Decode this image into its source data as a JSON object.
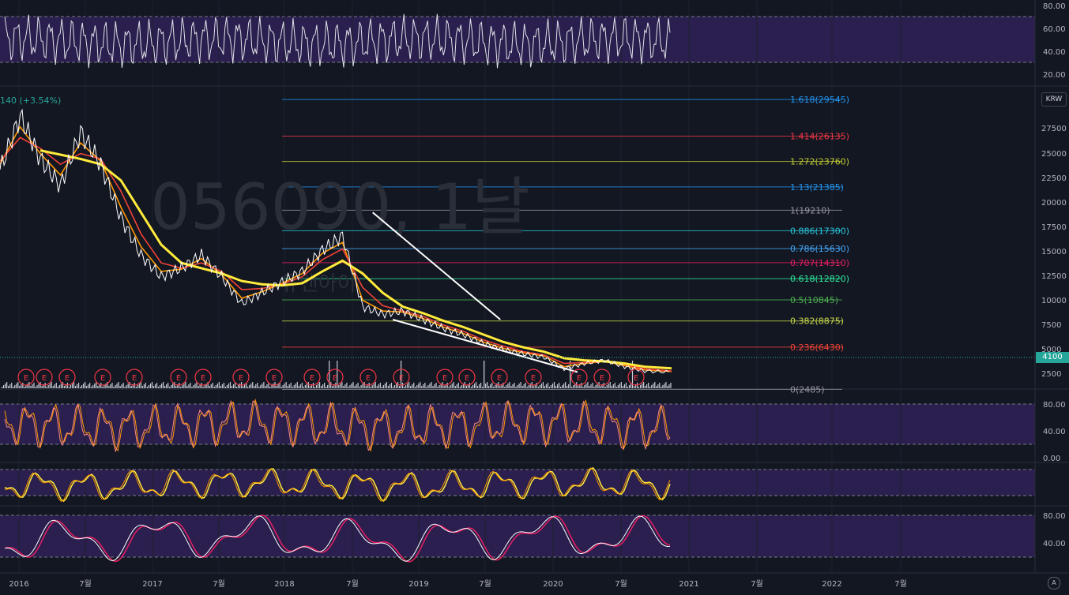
{
  "chart_data": {
    "type": "line",
    "symbol": "056090",
    "interval": "1날",
    "watermark": "056090, 1날",
    "watermark_sub": "유앤아이",
    "change_label": "140 (+3.54%)",
    "currency": "KRW",
    "last_price": "4100",
    "x_ticks": [
      "2016",
      "7월",
      "2017",
      "7월",
      "2018",
      "7월",
      "2019",
      "7월",
      "2020",
      "7월",
      "2021",
      "7월",
      "2022",
      "7월"
    ],
    "price_axis_ticks": [
      "27500",
      "25000",
      "22500",
      "20000",
      "17500",
      "15000",
      "12500",
      "10000",
      "7500",
      "5000",
      "2500"
    ],
    "ylim": [
      2000,
      30000
    ],
    "fibonacci": [
      {
        "label": "1.618(29545)",
        "value": 29545,
        "color": "#2196f3"
      },
      {
        "label": "1.414(26135)",
        "value": 26135,
        "color": "#f23645"
      },
      {
        "label": "1.272(23760)",
        "value": 23760,
        "color": "#c0ca33"
      },
      {
        "label": "1.13(21385)",
        "value": 21385,
        "color": "#2196f3"
      },
      {
        "label": "1(19210)",
        "value": 19210,
        "color": "#9598a1"
      },
      {
        "label": "0.886(17300)",
        "value": 17300,
        "color": "#26c6da"
      },
      {
        "label": "0.786(15630)",
        "value": 15630,
        "color": "#42a5f5"
      },
      {
        "label": "0.707(14310)",
        "value": 14310,
        "color": "#e91e63"
      },
      {
        "label": "0.618(12820)",
        "value": 12820,
        "color": "#2ee89a"
      },
      {
        "label": "0.5(10845)",
        "value": 10845,
        "color": "#4caf50"
      },
      {
        "label": "0.382(8875)",
        "value": 8875,
        "color": "#c6d84a"
      },
      {
        "label": "0.236(6430)",
        "value": 6430,
        "color": "#f44336"
      },
      {
        "label": "0(2485)",
        "value": 2485,
        "color": "#9598a1"
      }
    ],
    "earnings_marker": "E",
    "earnings_count": 21,
    "price_series": {
      "x": [
        0,
        0.03,
        0.06,
        0.09,
        0.12,
        0.15,
        0.18,
        0.21,
        0.24,
        0.27,
        0.3,
        0.33,
        0.36,
        0.39,
        0.42,
        0.45,
        0.48,
        0.51,
        0.54,
        0.57,
        0.6,
        0.63,
        0.66,
        0.69,
        0.72,
        0.75,
        0.78,
        0.81,
        0.84,
        0.87,
        0.9,
        0.93,
        0.96,
        1.0
      ],
      "values": [
        23000,
        28000,
        24000,
        21500,
        26500,
        23500,
        18500,
        15000,
        13000,
        13800,
        15000,
        13000,
        10500,
        11500,
        12500,
        13500,
        15500,
        16800,
        10200,
        9500,
        9800,
        9000,
        8200,
        7600,
        6800,
        6200,
        5800,
        5500,
        4400,
        4900,
        5200,
        4600,
        4200,
        4100
      ]
    },
    "moving_averages": [
      {
        "values": [
          23500,
          27000,
          24500,
          22500,
          25500,
          23800,
          19500,
          15800,
          13500,
          13700,
          14700,
          13200,
          11000,
          11600,
          12400,
          13300,
          15200,
          16200,
          10800,
          9800,
          9700,
          9100,
          8300,
          7700,
          6900,
          6300,
          5900,
          5600,
          4600,
          4900,
          5100,
          4700,
          4300,
          4150
        ],
        "color": "#ff9800"
      },
      {
        "values": [
          23800,
          26000,
          25000,
          23500,
          24500,
          24000,
          21000,
          17000,
          14300,
          13800,
          14300,
          13500,
          11800,
          11900,
          12300,
          13000,
          14600,
          15600,
          12000,
          10300,
          9800,
          9300,
          8500,
          7900,
          7100,
          6500,
          6000,
          5700,
          4900,
          5000,
          5100,
          4800,
          4400,
          4200
        ],
        "color": "#f44336"
      },
      {
        "values": [
          null,
          null,
          24800,
          24400,
          24000,
          23500,
          22000,
          19000,
          16000,
          14300,
          13800,
          13300,
          12600,
          12300,
          12200,
          12400,
          13500,
          14500,
          13300,
          11500,
          10200,
          9600,
          8900,
          8300,
          7600,
          6900,
          6400,
          6000,
          5400,
          5200,
          5100,
          4900,
          4600,
          4450
        ],
        "color": "#ffeb3b"
      }
    ],
    "trendlines": [
      {
        "from": [
          0.555,
          19000
        ],
        "to": [
          0.745,
          9000
        ]
      },
      {
        "from": [
          0.585,
          9000
        ],
        "to": [
          0.86,
          4100
        ]
      }
    ],
    "rsi_top": {
      "ticks": [
        "80.00",
        "60.00",
        "40.00",
        "20.00"
      ],
      "upper": 70,
      "lower": 30
    },
    "stoch_1": {
      "ticks": [
        "80.00",
        "40.00",
        "0.00"
      ],
      "upper": 80,
      "lower": 20
    },
    "stoch_2": {
      "upper": 80,
      "lower": 20
    },
    "stoch_3": {
      "ticks": [
        "80.00",
        "40.00"
      ],
      "upper": 80,
      "lower": 20
    }
  },
  "ui": {
    "corner_button": "A"
  }
}
